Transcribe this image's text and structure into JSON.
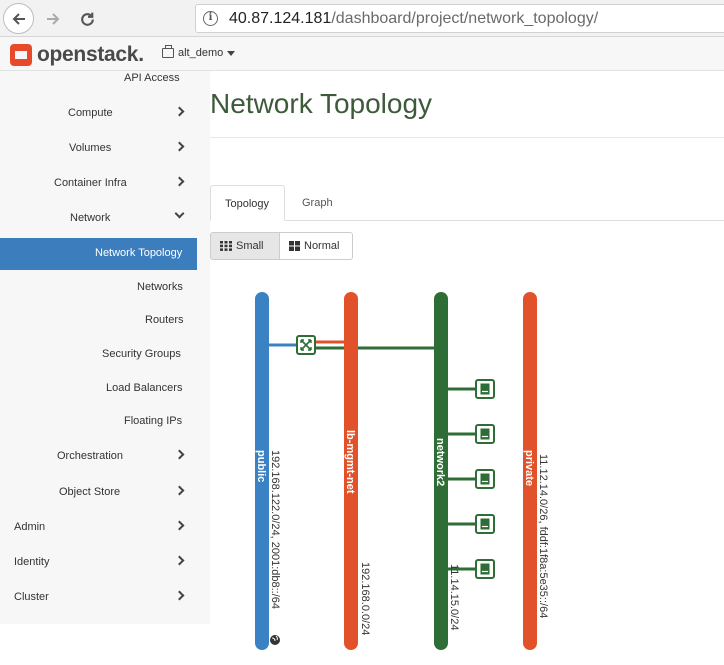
{
  "browser": {
    "url_host": "40.87.124.181",
    "url_path": "/dashboard/project/network_topology/",
    "info_glyph": "i"
  },
  "header": {
    "brand": "openstack",
    "brand_suffix": ".",
    "project": "alt_demo"
  },
  "sidebar": {
    "items": [
      {
        "label": "API Access"
      },
      {
        "label": "Compute"
      },
      {
        "label": "Volumes"
      },
      {
        "label": "Container Infra"
      },
      {
        "label": "Network"
      },
      {
        "label": "Network Topology"
      },
      {
        "label": "Networks"
      },
      {
        "label": "Routers"
      },
      {
        "label": "Security Groups"
      },
      {
        "label": "Load Balancers"
      },
      {
        "label": "Floating IPs"
      },
      {
        "label": "Orchestration"
      },
      {
        "label": "Object Store"
      },
      {
        "label": "Admin"
      },
      {
        "label": "Identity"
      },
      {
        "label": "Cluster"
      }
    ]
  },
  "main": {
    "title": "Network Topology",
    "tabs": [
      {
        "label": "Topology"
      },
      {
        "label": "Graph"
      }
    ],
    "size_buttons": [
      {
        "label": "Small"
      },
      {
        "label": "Normal"
      }
    ]
  },
  "topology": {
    "networks": [
      {
        "name": "public",
        "cidr": "192.168.122.0/24, 2001:db8::/64",
        "color": "#3b82c4"
      },
      {
        "name": "lb-mgmt-net",
        "cidr": "192.168.0.0/24",
        "color": "#e2522a"
      },
      {
        "name": "network2",
        "cidr": "11.14.15.0/24",
        "color": "#2e6e36"
      },
      {
        "name": "private",
        "cidr": "11.12.14.0/26, fddf:1f8a:5e35::/64",
        "color": "#e2522a"
      }
    ],
    "router_icon": "router-icon",
    "instance_icon": "instance-icon",
    "external_icon": "globe-icon",
    "instances_on_network2": 5
  },
  "colors": {
    "active_nav": "#3b7dbd",
    "title": "#3d5a3b"
  }
}
